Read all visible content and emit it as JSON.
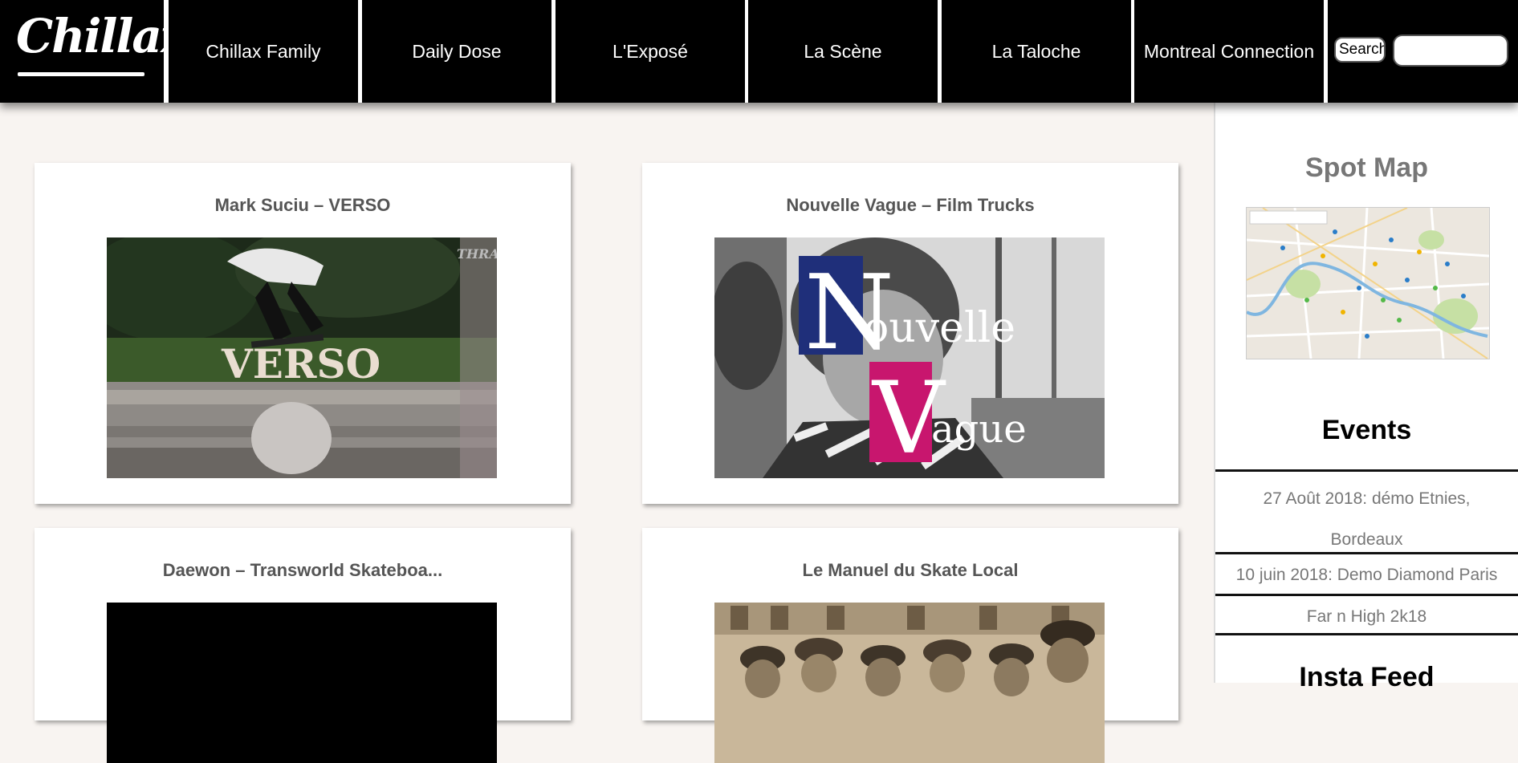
{
  "header": {
    "logo_text": "Chillax",
    "nav": [
      "Chillax Family",
      "Daily Dose",
      "L'Exposé",
      "La Scène",
      "La Taloche",
      "Montreal Connection"
    ],
    "search_button": "Search",
    "search_value": ""
  },
  "posts": [
    {
      "title": "Mark Suciu – VERSO",
      "thumb_text": "VERSO",
      "watermark": "THRAS"
    },
    {
      "title": "Nouvelle Vague – Film Trucks",
      "thumb_n": "N",
      "thumb_ouvelle": "ouvelle",
      "thumb_v": "V",
      "thumb_ague": "ague"
    },
    {
      "title": "Daewon – Transworld Skateboa..."
    },
    {
      "title": "Le Manuel du Skate Local"
    }
  ],
  "sidebar": {
    "spot_map_title": "Spot Map",
    "events_title": "Events",
    "events": [
      "27 Août 2018: démo Etnies, Bordeaux",
      "10 juin 2018: Demo Diamond Paris",
      "Far n High 2k18"
    ],
    "insta_title": "Insta Feed"
  },
  "colors": {
    "page_bg": "#f8f4f1",
    "nav_bg": "#000000",
    "title_grey": "#555555",
    "sidebar_grey": "#777777",
    "nv_blue": "#1f2f7a",
    "nv_pink": "#c8166e"
  }
}
